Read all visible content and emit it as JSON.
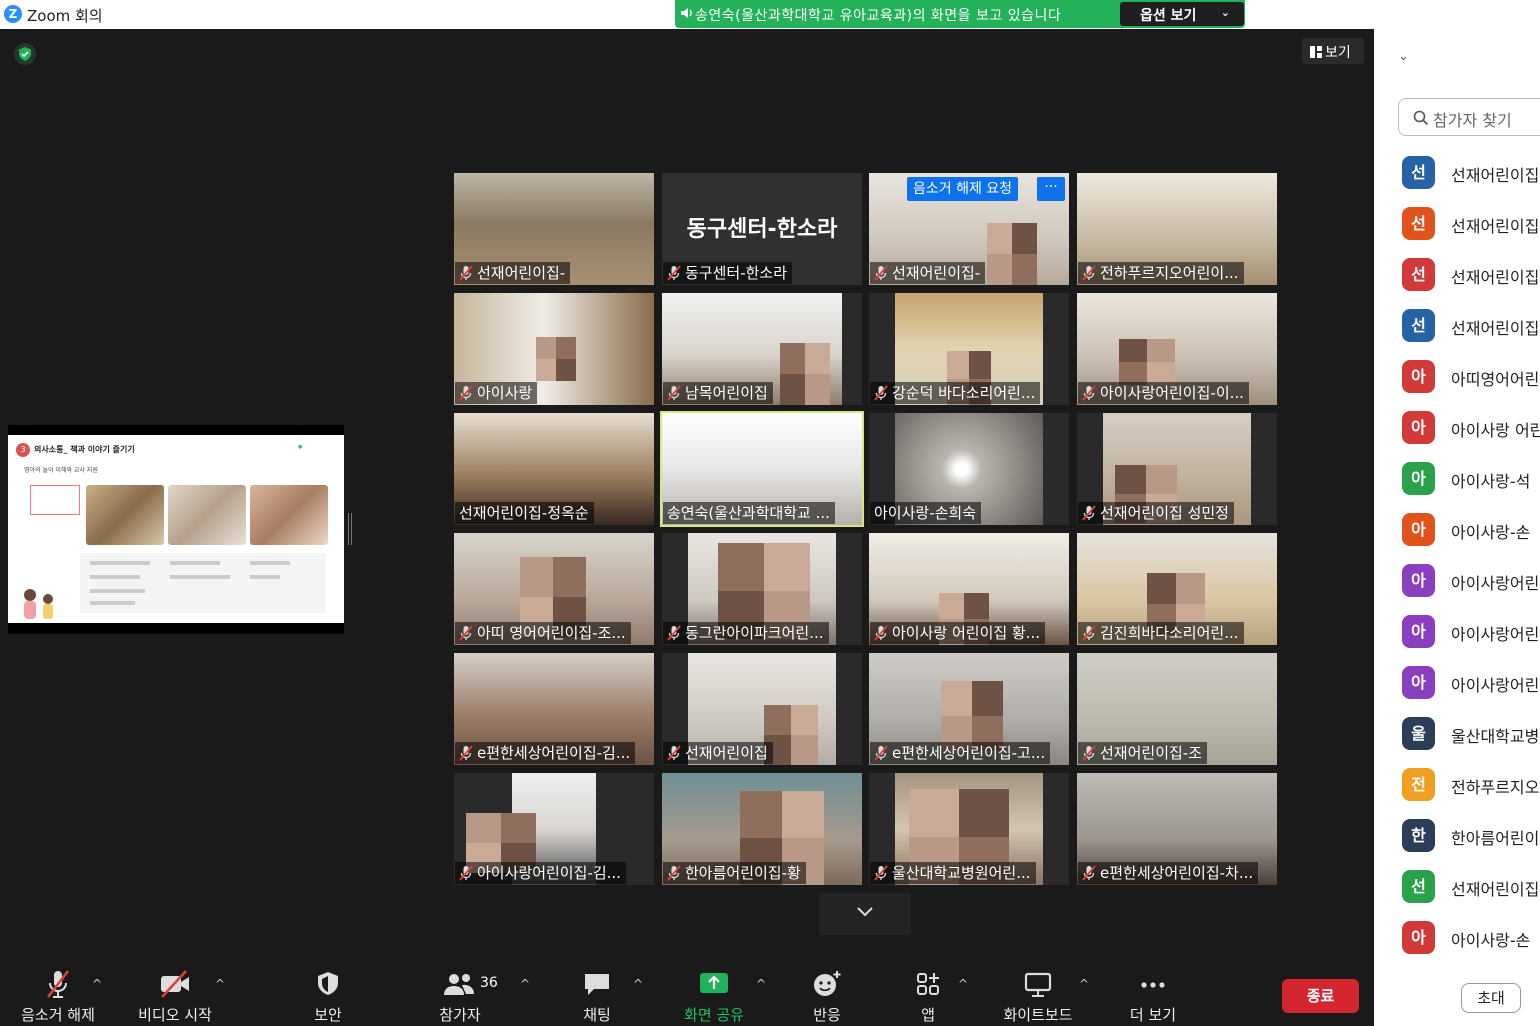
{
  "window": {
    "app_title": "Zoom 회의",
    "logo_letter": "Z"
  },
  "banner": {
    "text": "송연숙(울산과학대학교 유아교육과)의 화면을 보고 있습니다",
    "view_options_label": "옵션 보기"
  },
  "meeting": {
    "view_label": "보기"
  },
  "shared_slide": {
    "number": "3",
    "title": "의사소통_ 책과 이야기 즐기기",
    "subtitle": "영아의 놀이 이해와 교사 지원"
  },
  "tiles": [
    {
      "label": "선재어린이집-",
      "muted": true
    },
    {
      "label": "동구센터-한소라",
      "muted": true,
      "big_name": "동구센터-한소라"
    },
    {
      "label": "선재어린이집-",
      "muted": true,
      "unmute_request": "음소거 해제 요청",
      "more": "···"
    },
    {
      "label": "전하푸르지오어린이...",
      "muted": true
    },
    {
      "label": "아이사랑",
      "muted": true
    },
    {
      "label": "남목어린이집",
      "muted": true
    },
    {
      "label": "강순덕 바다소리어린...",
      "muted": true
    },
    {
      "label": "아이사랑어린이집-이...",
      "muted": true
    },
    {
      "label": "선재어린이집-정옥순",
      "muted": false
    },
    {
      "label": "송연숙(울산과학대학교 ...",
      "muted": false,
      "active": true
    },
    {
      "label": "아이사랑-손희숙",
      "muted": false
    },
    {
      "label": "선재어린이집 성민정",
      "muted": true
    },
    {
      "label": "아띠 영어어린이집-조...",
      "muted": true
    },
    {
      "label": "동그란아이파크어린...",
      "muted": true
    },
    {
      "label": "아이사랑 어린이집 황...",
      "muted": true
    },
    {
      "label": "김진희바다소리어린...",
      "muted": true
    },
    {
      "label": "e편한세상어린이집-김...",
      "muted": true
    },
    {
      "label": "선재어린이집",
      "muted": true
    },
    {
      "label": "e편한세상어린이집-고...",
      "muted": true
    },
    {
      "label": "선재어린이집-조",
      "muted": true
    },
    {
      "label": "아이사랑어린이집-김...",
      "muted": true
    },
    {
      "label": "한아름어린이집-황",
      "muted": true
    },
    {
      "label": "울산대학교병원어린...",
      "muted": true
    },
    {
      "label": "e편한세상어린이집-차...",
      "muted": true
    }
  ],
  "toolbar": {
    "unmute": "음소거 해제",
    "start_video": "비디오 시작",
    "security": "보안",
    "participants": "참가자",
    "participants_count": "36",
    "chat": "채팅",
    "share_screen": "화면 공유",
    "reactions": "반응",
    "apps": "앱",
    "whiteboard": "화이트보드",
    "more": "더 보기",
    "end": "종료"
  },
  "panel": {
    "search_placeholder": "참가자 찾기",
    "invite": "초대",
    "participants": [
      {
        "initial": "선",
        "name": "선재어린이집",
        "color": "#2563a6"
      },
      {
        "initial": "선",
        "name": "선재어린이집",
        "color": "#e0531d"
      },
      {
        "initial": "선",
        "name": "선재어린이집",
        "color": "#d23a3a"
      },
      {
        "initial": "선",
        "name": "선재어린이집",
        "color": "#2563a6"
      },
      {
        "initial": "아",
        "name": "아띠영어어린",
        "color": "#d23a3a"
      },
      {
        "initial": "아",
        "name": "아이사랑 어린",
        "color": "#d23a3a"
      },
      {
        "initial": "아",
        "name": "아이사랑-석",
        "color": "#2aa14b"
      },
      {
        "initial": "아",
        "name": "아이사랑-손",
        "color": "#e0531d"
      },
      {
        "initial": "아",
        "name": "아이사랑어린",
        "color": "#8a3fc1"
      },
      {
        "initial": "아",
        "name": "아이사랑어린",
        "color": "#8a3fc1"
      },
      {
        "initial": "아",
        "name": "아이사랑어린",
        "color": "#8a3fc1"
      },
      {
        "initial": "울",
        "name": "울산대학교병",
        "color": "#2c3e57"
      },
      {
        "initial": "전",
        "name": "전하푸르지오",
        "color": "#f0a020"
      },
      {
        "initial": "한",
        "name": "한아름어린이",
        "color": "#2c3e57"
      },
      {
        "initial": "선",
        "name": "선재어린이집",
        "color": "#2aa14b"
      },
      {
        "initial": "아",
        "name": "아이사랑-손",
        "color": "#d23a3a"
      }
    ]
  }
}
